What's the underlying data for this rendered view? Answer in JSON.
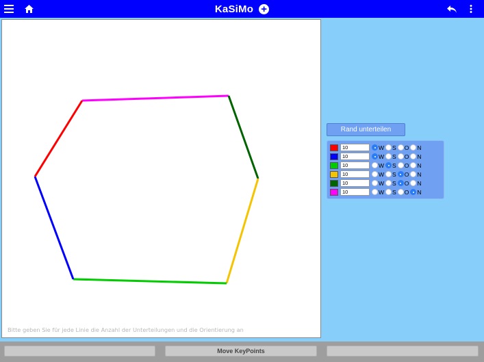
{
  "header": {
    "title": "KaSiMo",
    "menu_icon": "hamburger-icon",
    "home_icon": "home-icon",
    "add_icon": "plus-circle-icon",
    "back_icon": "undo-arrow-icon",
    "more_icon": "vertical-dots-icon"
  },
  "canvas": {
    "hint": "Bitte geben Sie für jede Linie die Anzahl der Unterteilungen und die Orientierung an"
  },
  "subdivide_button": {
    "label": "Rand unterteilen"
  },
  "lines": [
    {
      "color": "#ff0000",
      "count": "10",
      "selected": "W"
    },
    {
      "color": "#0000ff",
      "count": "10",
      "selected": "W"
    },
    {
      "color": "#00cc00",
      "count": "10",
      "selected": "S"
    },
    {
      "color": "#f5c400",
      "count": "10",
      "selected": "O"
    },
    {
      "color": "#006400",
      "count": "10",
      "selected": "O"
    },
    {
      "color": "#ff00ff",
      "count": "10",
      "selected": "N"
    }
  ],
  "orientations": [
    "W",
    "S",
    "O",
    "N"
  ],
  "bottom": {
    "left_label": "",
    "center_label": "Move KeyPoints",
    "right_label": ""
  }
}
